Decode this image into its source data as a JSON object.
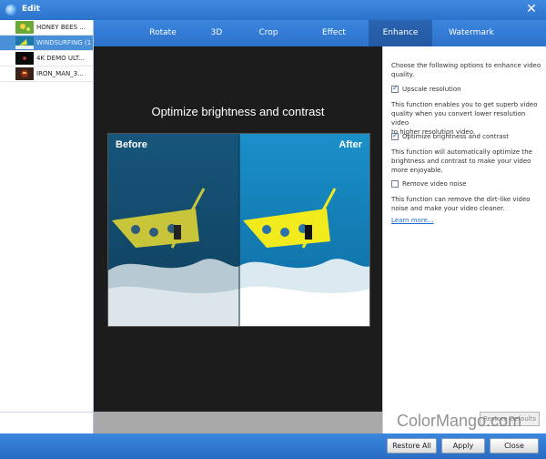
{
  "window": {
    "title": "Edit"
  },
  "files": [
    {
      "name": "HONEY BEES ...",
      "thumb": "bees-thumbnail",
      "selected": false
    },
    {
      "name": "WINDSURFING (1)...",
      "thumb": "surf-thumbnail",
      "selected": true
    },
    {
      "name": "4K DEMO ULT...",
      "thumb": "dark-thumbnail",
      "selected": false
    },
    {
      "name": "IRON_MAN_3...",
      "thumb": "ironman-thumbnail",
      "selected": false
    }
  ],
  "tabs": [
    {
      "label": "Rotate"
    },
    {
      "label": "3D"
    },
    {
      "label": "Crop"
    },
    {
      "label": "Effect"
    },
    {
      "label": "Enhance",
      "active": true
    },
    {
      "label": "Watermark"
    }
  ],
  "preview": {
    "title": "Optimize brightness and contrast",
    "before_label": "Before",
    "after_label": "After"
  },
  "options": {
    "intro_line1": "Choose the following options to enhance video",
    "intro_line2": "quality.",
    "upscale": {
      "label": "Upscale resolution",
      "checked": true
    },
    "upscale_desc1": "This function enables you to get superb video",
    "upscale_desc2": "quality when you convert lower resolution video",
    "upscale_desc3": "to higher resolution video.",
    "brightness": {
      "label": "Optimize brightness and contrast",
      "checked": true
    },
    "brightness_desc1": "This function will automatically optimize the",
    "brightness_desc2": "brightness and contrast to make your video",
    "brightness_desc3": "more enjoyable.",
    "noise": {
      "label": "Remove video noise",
      "checked": false
    },
    "noise_desc1": "This function can remove the dirt-like video",
    "noise_desc2": "noise and make your video cleaner.",
    "learn_more": "Learn more...",
    "restore_defaults": "Restore Defaults"
  },
  "buttons": {
    "restore_all": "Restore All",
    "apply": "Apply",
    "close": "Close"
  },
  "watermark": "ColorMango.com",
  "colors": {
    "accent": "#2c72cc",
    "selected_row": "#4a90d9",
    "link": "#1a6fd0"
  }
}
